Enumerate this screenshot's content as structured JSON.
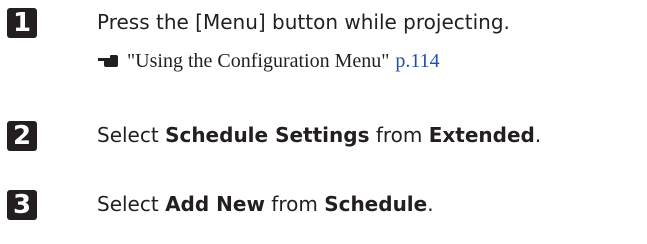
{
  "steps": [
    {
      "number": "1",
      "text": "Press the [Menu] button while projecting.",
      "reference": {
        "icon": "pointing-hand-icon",
        "title": "\"Using the Configuration Menu\"",
        "page": "p.114"
      }
    },
    {
      "number": "2",
      "parts": {
        "a": "Select ",
        "b": "Schedule Settings",
        "c": " from ",
        "d": "Extended",
        "e": "."
      }
    },
    {
      "number": "3",
      "parts": {
        "a": "Select ",
        "b": "Add New",
        "c": " from ",
        "d": "Schedule",
        "e": "."
      }
    }
  ]
}
